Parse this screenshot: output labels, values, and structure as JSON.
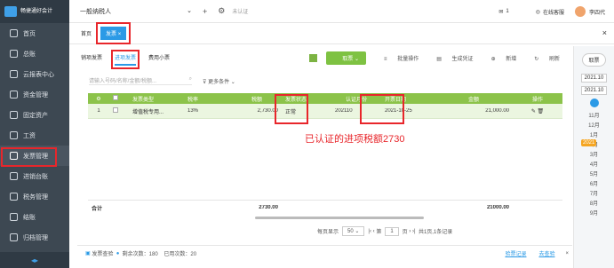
{
  "app": {
    "logo_text": "畅捷通好会计",
    "logo_sub": "好会计"
  },
  "sidebar": {
    "items": [
      {
        "label": "首页"
      },
      {
        "label": "总账"
      },
      {
        "label": "云报表中心"
      },
      {
        "label": "资金管理"
      },
      {
        "label": "固定资产"
      },
      {
        "label": "工资"
      },
      {
        "label": "发票管理"
      },
      {
        "label": "进销台账"
      },
      {
        "label": "税务管理"
      },
      {
        "label": "结账"
      },
      {
        "label": "归档管理"
      }
    ],
    "active": "发票管理"
  },
  "topbar": {
    "company": "一般纳税人",
    "cert_status": "未认证",
    "badge": "1",
    "service": "在线客服",
    "user": "李四代"
  },
  "page_tabs": [
    {
      "label": "首页"
    },
    {
      "label": "发票"
    }
  ],
  "subtabs": [
    {
      "label": "销项发票"
    },
    {
      "label": "进项发票"
    },
    {
      "label": "费用小票"
    }
  ],
  "search": {
    "placeholder": "请输入号码/名称/金额/税额..."
  },
  "filter_more": "更多条件",
  "toolbar": {
    "receive": "取票",
    "batch": "批量操作",
    "voucher": "生成凭证",
    "add": "新增",
    "refresh": "刷新"
  },
  "table": {
    "headers": [
      "序号",
      "",
      "发票类型",
      "税率",
      "税额",
      "发票状态",
      "认证月份",
      "开票日期",
      "金额",
      "操作"
    ],
    "rows": [
      {
        "seq": "1",
        "type": "增值税专用...",
        "rate": "13%",
        "tax": "2,730.00",
        "status": "正常",
        "cert_month": "202110",
        "date": "2021-10-25",
        "amount": "21,000.00"
      }
    ],
    "total_label": "合计",
    "total_tax": "2730.00",
    "total_amount": "21000.00"
  },
  "annotation": "已认证的进项税额2730",
  "pager": {
    "per_page_label": "每页显示",
    "per_page": "50",
    "page_prefix": "第",
    "page": "1",
    "page_suffix": "页",
    "summary": "共1页,1条记录"
  },
  "bottom": {
    "check": "发票查验",
    "remaining": "剩余次数：180",
    "used": "已用次数：20",
    "history": "验票记录",
    "go": "去查验"
  },
  "rightpanel": {
    "btn": "取票",
    "date_from": "2021.10",
    "date_to": "2021.10",
    "year": "2021",
    "months": [
      "11月",
      "12月",
      "1月",
      "2月",
      "3月",
      "4月",
      "5月",
      "6月",
      "7月",
      "8月",
      "9月"
    ]
  }
}
